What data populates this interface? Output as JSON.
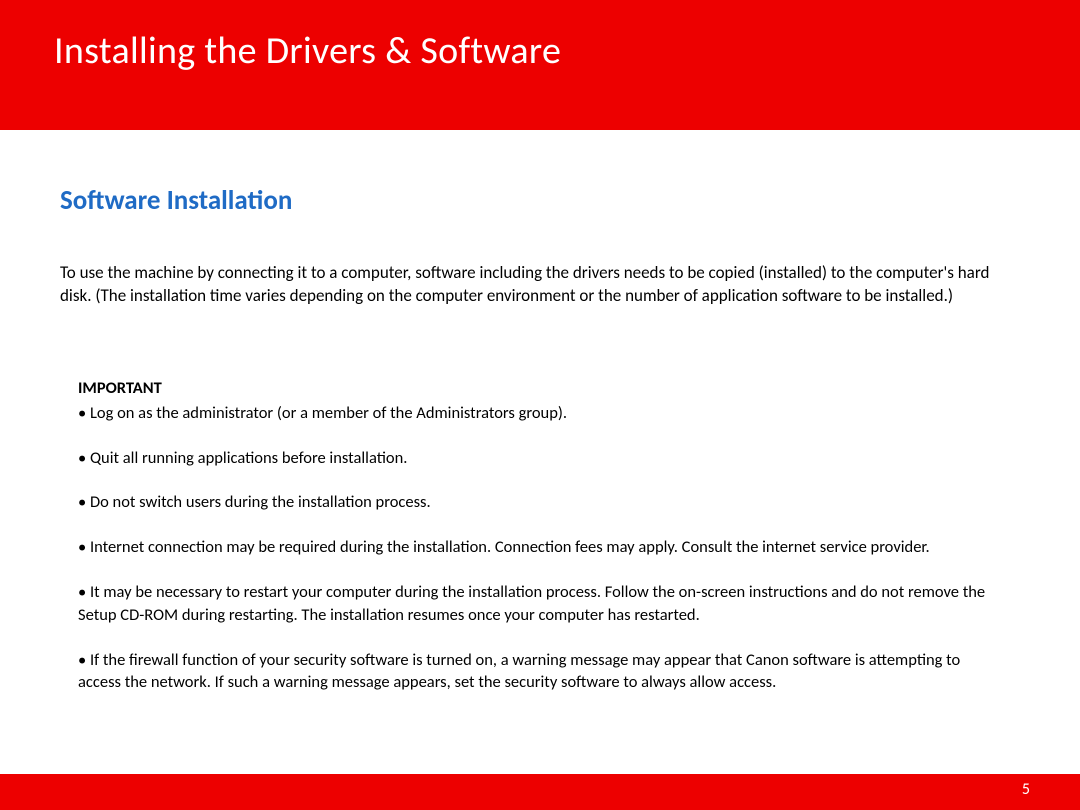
{
  "header": {
    "title": "Installing  the Drivers & Software"
  },
  "section": {
    "heading": "Software Installation",
    "intro": "To use the machine by connecting it to a computer, software including the drivers needs to be copied (installed) to the computer's hard disk. (The installation time varies depending on the computer environment or the number of application software to be installed.)"
  },
  "important": {
    "label": "IMPORTANT",
    "items": [
      "• Log on as the administrator (or a member of the Administrators group).",
      "• Quit all running applications before installation.",
      "• Do not switch users during the installation process.",
      "• Internet connection may be required during the installation. Connection fees may apply. Consult the internet service provider.",
      "• It may be necessary to restart your computer during the installation process. Follow the on-screen instructions and do not remove the Setup CD-ROM during restarting. The installation resumes once your computer has restarted.",
      "• If the firewall function of your security software is turned on, a warning message may appear that Canon software is attempting to access the network. If such a warning message appears, set the security software to always allow access."
    ]
  },
  "footer": {
    "page_number": "5"
  }
}
